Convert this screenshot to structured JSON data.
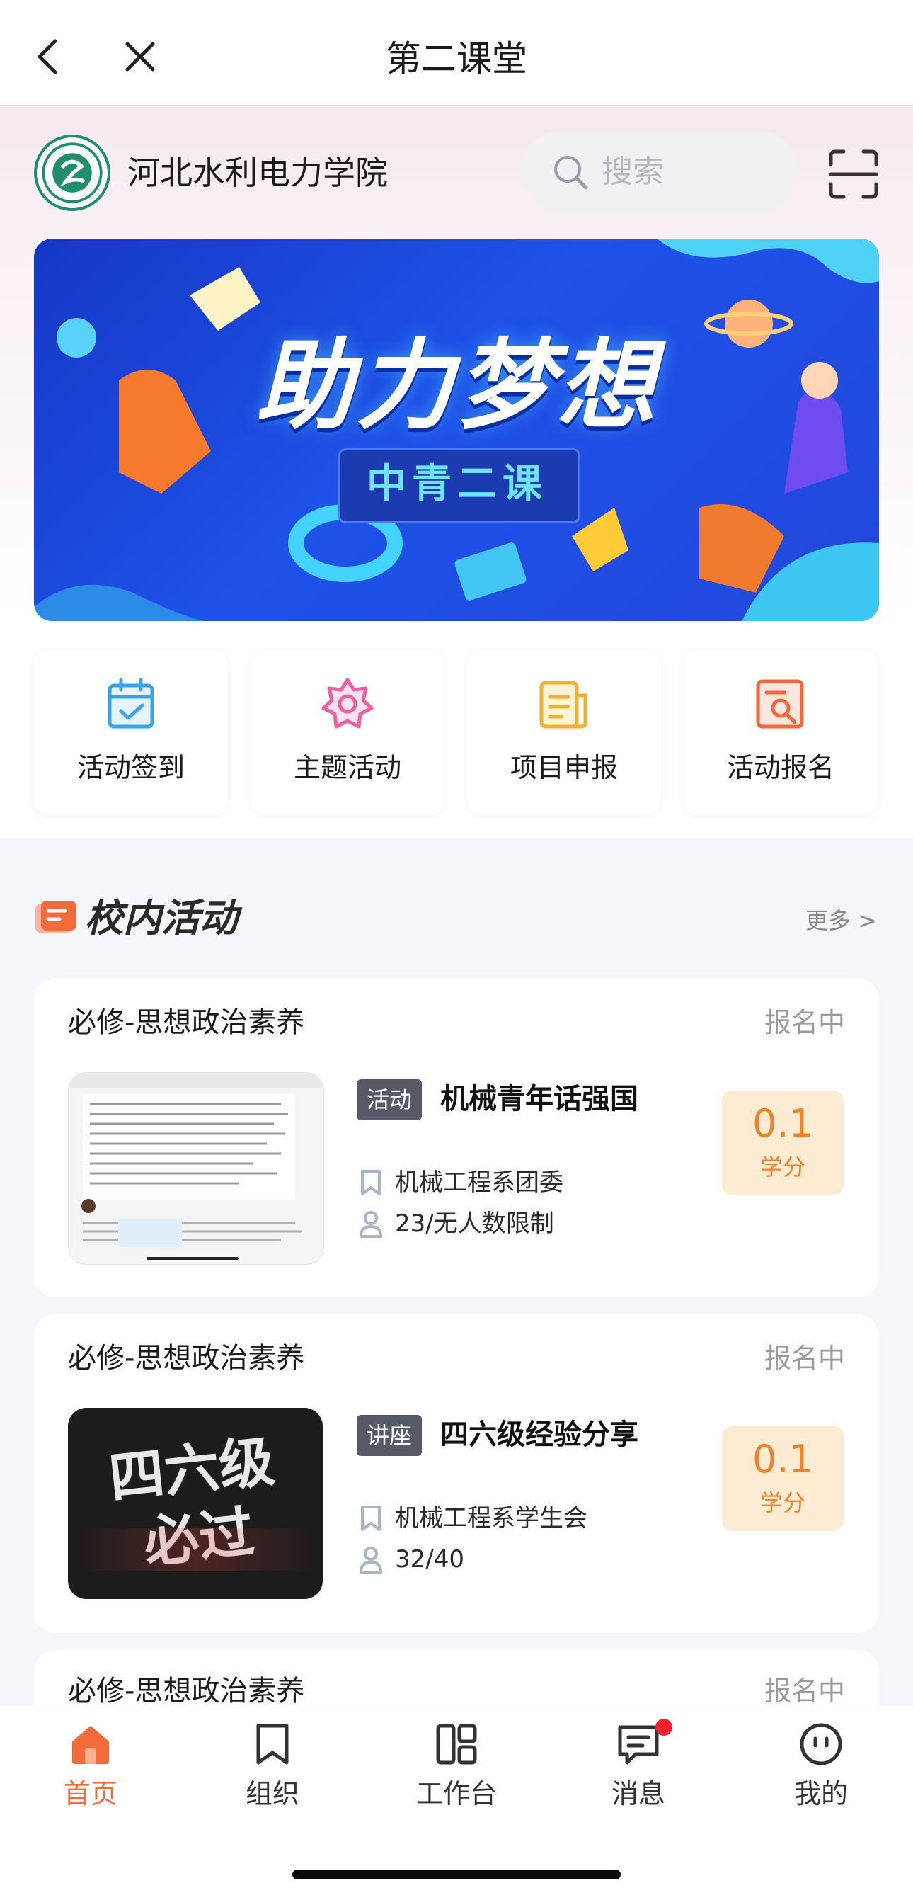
{
  "nav": {
    "title": "第二课堂"
  },
  "header": {
    "school_name": "河北水利电力学院",
    "search_placeholder": "搜索"
  },
  "banner": {
    "title": "助力梦想",
    "subtitle": "中青二课"
  },
  "quick_actions": [
    {
      "label": "活动签到",
      "icon": "calendar-check-icon",
      "color": "#3aa3e8"
    },
    {
      "label": "主题活动",
      "icon": "badge-star-icon",
      "color": "#ee5fa0"
    },
    {
      "label": "项目申报",
      "icon": "document-report-icon",
      "color": "#f2b12c"
    },
    {
      "label": "活动报名",
      "icon": "search-document-icon",
      "color": "#f2673a"
    }
  ],
  "section": {
    "title": "校内活动",
    "more": "更多 >"
  },
  "activities": [
    {
      "category": "必修-思想政治素养",
      "status": "报名中",
      "tag": "活动",
      "title": "机械青年话强国",
      "organizer": "机械工程系团委",
      "participants": "23/无人数限制",
      "credit": "0.1",
      "credit_unit": "学分"
    },
    {
      "category": "必修-思想政治素养",
      "status": "报名中",
      "tag": "讲座",
      "title": "四六级经验分享",
      "organizer": "机械工程系学生会",
      "participants": "32/40",
      "credit": "0.1",
      "credit_unit": "学分",
      "thumb_text": "四六级 必过"
    },
    {
      "category": "必修-思想政治素养",
      "status": "报名中"
    }
  ],
  "tabs": [
    {
      "label": "首页",
      "icon": "home-icon",
      "active": true
    },
    {
      "label": "组织",
      "icon": "bookmark-icon"
    },
    {
      "label": "工作台",
      "icon": "dashboard-icon"
    },
    {
      "label": "消息",
      "icon": "message-icon",
      "badge": true
    },
    {
      "label": "我的",
      "icon": "profile-face-icon"
    }
  ],
  "colors": {
    "accent": "#f26b3a",
    "credit_bg": "#fdebd2",
    "credit_text": "#f0802a",
    "badge": "#f0212b"
  }
}
